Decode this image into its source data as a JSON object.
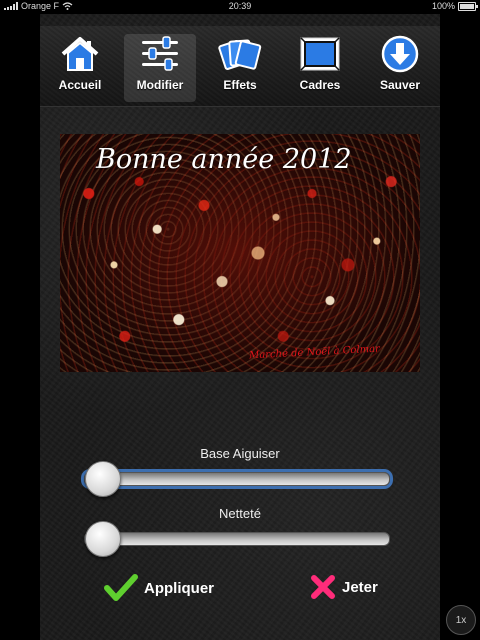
{
  "status_bar": {
    "carrier": "Orange F",
    "time": "20:39",
    "battery": "100%"
  },
  "toolbar": {
    "items": [
      {
        "label": "Accueil",
        "icon": "home-icon",
        "active": false
      },
      {
        "label": "Modifier",
        "icon": "sliders-icon",
        "active": true
      },
      {
        "label": "Effets",
        "icon": "photos-icon",
        "active": false
      },
      {
        "label": "Cadres",
        "icon": "frame-icon",
        "active": false
      },
      {
        "label": "Sauver",
        "icon": "download-icon",
        "active": false
      }
    ]
  },
  "photo": {
    "caption": "Bonne année 2012",
    "signature": "Marché de Noël à Colmar"
  },
  "sliders": [
    {
      "label": "Base Aiguiser",
      "value": 0.0,
      "focused": true
    },
    {
      "label": "Netteté",
      "value": 0.0,
      "focused": false
    }
  ],
  "actions": {
    "apply_label": "Appliquer",
    "discard_label": "Jeter"
  },
  "zoom": {
    "label": "1x"
  },
  "colors": {
    "accent_blue": "#2b7be4",
    "apply_green": "#5fcf2f",
    "discard_pink": "#ff2c7a"
  }
}
